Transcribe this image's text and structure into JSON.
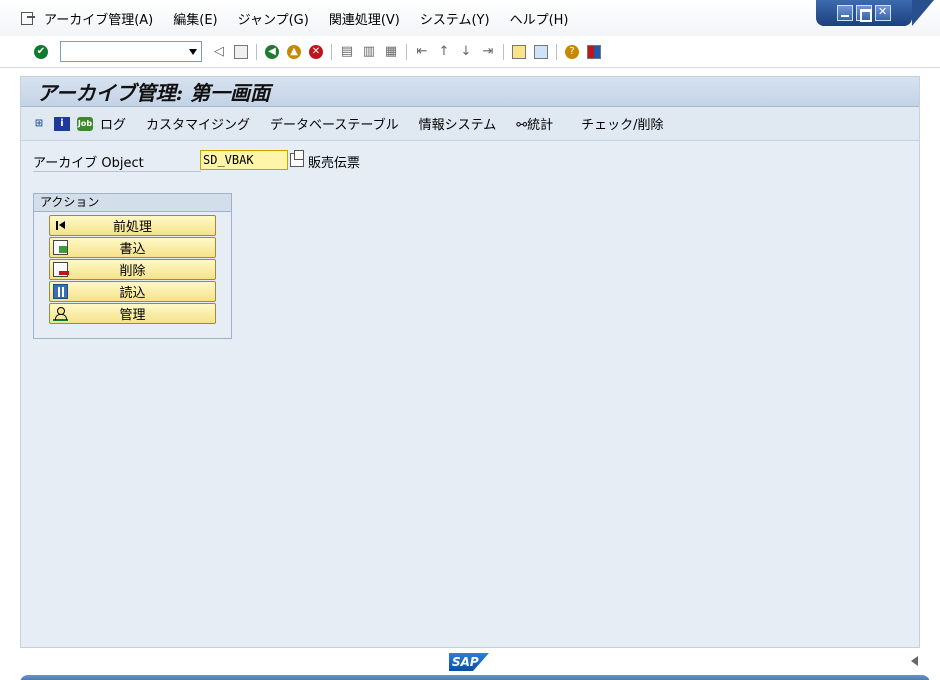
{
  "menu": {
    "items": [
      "アーカイブ管理(A)",
      "編集(E)",
      "ジャンプ(G)",
      "関連処理(V)",
      "システム(Y)",
      "ヘルプ(H)"
    ]
  },
  "toolbar": {
    "command_value": "",
    "icons": [
      "enter-icon",
      "dropdown-icon",
      "collapse-icon",
      "save-icon",
      "back-icon",
      "exit-icon",
      "cancel-icon",
      "print-icon",
      "find-icon",
      "find-next-icon",
      "first-page-icon",
      "prev-page-icon",
      "next-page-icon",
      "last-page-icon",
      "create-session-icon",
      "shortcut-icon",
      "help-icon",
      "layout-icon"
    ]
  },
  "screen": {
    "title": "アーカイブ管理: 第一画面"
  },
  "app_toolbar": {
    "job_icon_label": "Job",
    "log": "ログ",
    "customizing": "カスタマイジング",
    "db_tables": "データベーステーブル",
    "info_system": "情報システム",
    "statistics": "統計",
    "check_delete": "チェック/削除"
  },
  "form": {
    "object_label": "アーカイブ Object",
    "object_value": "SD_VBAK",
    "object_desc": "販売伝票"
  },
  "actions": {
    "title": "アクション",
    "preprocess": "前処理",
    "write": "書込",
    "delete": "削除",
    "read": "読込",
    "manage": "管理"
  },
  "status": {
    "logo": "SAP"
  }
}
